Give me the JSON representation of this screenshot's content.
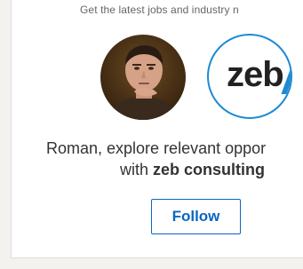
{
  "card": {
    "tagline": "Get the latest jobs and industry n",
    "member": {
      "first_name": "Roman",
      "avatar_icon": "person-photo-avatar"
    },
    "company": {
      "logo_text": "zeb",
      "logo_icon": "zeb-consulting-logo",
      "accent_color": "#1d8ad3"
    },
    "headline": {
      "line1": "Roman, explore relevant oppor",
      "line2_prefix": "with ",
      "company_name": "zeb consulting"
    },
    "follow_label": "Follow",
    "colors": {
      "brand_blue": "#0a66c2",
      "text": "#333333",
      "muted": "#666666"
    }
  }
}
